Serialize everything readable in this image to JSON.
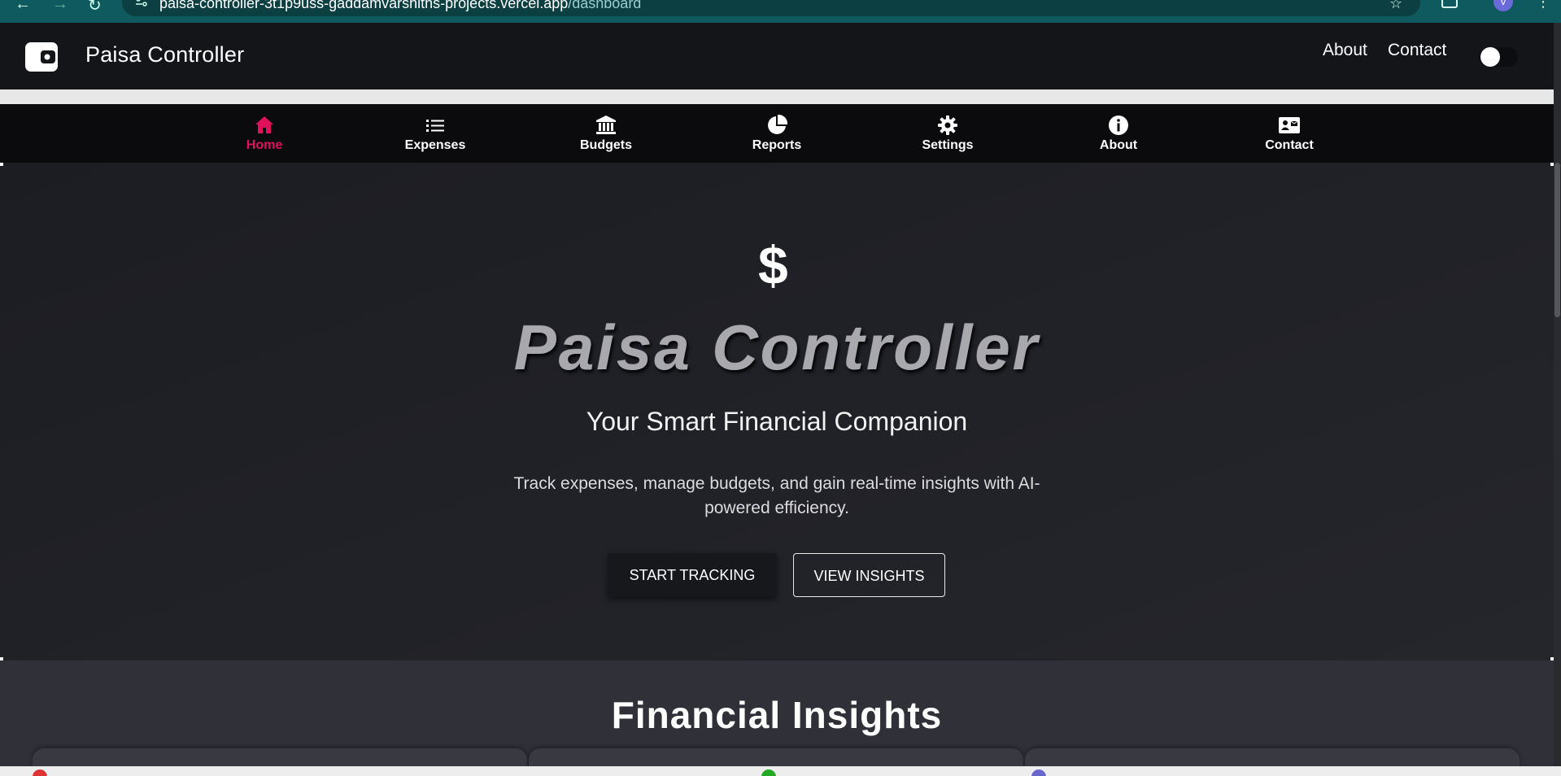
{
  "browser": {
    "url_host": "paisa-controller-3t1p9uss-gaddamvarshiths-projects.vercel.app",
    "url_path": "/dashboard",
    "profile_initial": "V"
  },
  "header": {
    "title": "Paisa Controller",
    "links": [
      "About",
      "Contact"
    ]
  },
  "tabs": [
    {
      "label": "Home",
      "icon": "home-icon",
      "active": true
    },
    {
      "label": "Expenses",
      "icon": "list-icon",
      "active": false
    },
    {
      "label": "Budgets",
      "icon": "bank-icon",
      "active": false
    },
    {
      "label": "Reports",
      "icon": "pie-chart-icon",
      "active": false
    },
    {
      "label": "Settings",
      "icon": "gear-icon",
      "active": false
    },
    {
      "label": "About",
      "icon": "info-icon",
      "active": false
    },
    {
      "label": "Contact",
      "icon": "contact-card-icon",
      "active": false
    }
  ],
  "hero": {
    "icon": "$",
    "title": "Paisa Controller",
    "subtitle": "Your Smart Financial Companion",
    "description": "Track expenses, manage budgets, and gain real-time insights with AI-powered efficiency.",
    "primary_button": "START TRACKING",
    "secondary_button": "VIEW INSIGHTS"
  },
  "insights": {
    "title": "Financial Insights"
  },
  "colors": {
    "accent": "#e0105a",
    "header_bg": "#141519",
    "nav_bg": "#0b0b0e",
    "hero_bg": "#202226"
  }
}
